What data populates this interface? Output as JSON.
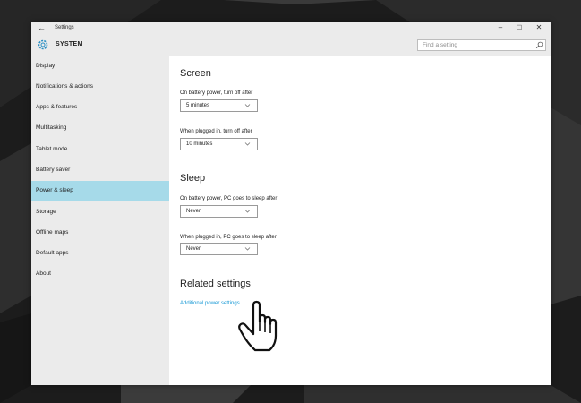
{
  "window": {
    "app_title": "Settings",
    "back_icon": "back-arrow-icon",
    "controls": {
      "minimize": "–",
      "maximize": "☐",
      "close": "✕"
    }
  },
  "header": {
    "icon": "gear-icon",
    "title": "SYSTEM",
    "search_placeholder": "Find a setting",
    "search_icon": "search-icon"
  },
  "sidebar": {
    "items": [
      {
        "label": "Display"
      },
      {
        "label": "Notifications & actions"
      },
      {
        "label": "Apps & features"
      },
      {
        "label": "Multitasking"
      },
      {
        "label": "Tablet mode"
      },
      {
        "label": "Battery saver"
      },
      {
        "label": "Power & sleep",
        "selected": true
      },
      {
        "label": "Storage"
      },
      {
        "label": "Offline maps"
      },
      {
        "label": "Default apps"
      },
      {
        "label": "About"
      }
    ]
  },
  "screen": {
    "heading": "Screen",
    "battery_label": "On battery power, turn off after",
    "battery_value": "5 minutes",
    "plugged_label": "When plugged in, turn off after",
    "plugged_value": "10 minutes"
  },
  "sleep": {
    "heading": "Sleep",
    "battery_label": "On battery power, PC goes to sleep after",
    "battery_value": "Never",
    "plugged_label": "When plugged in, PC goes to sleep after",
    "plugged_value": "Never"
  },
  "related": {
    "heading": "Related settings",
    "link": "Additional power settings"
  },
  "colors": {
    "accent_link": "#1a9ad6",
    "selected_nav": "#a6dae9",
    "chrome_bg": "#ebebeb"
  }
}
